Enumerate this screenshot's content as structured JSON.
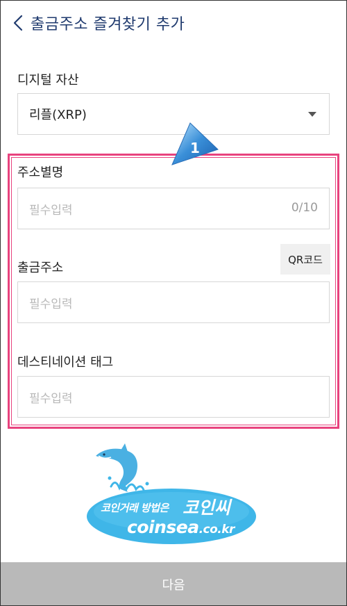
{
  "header": {
    "title": "출금주소 즐겨찾기 추가"
  },
  "asset": {
    "label": "디지털 자산",
    "selected": "리플(XRP)"
  },
  "alias": {
    "label": "주소별명",
    "placeholder": "필수입력",
    "counter": "0/10"
  },
  "address": {
    "label": "출금주소",
    "placeholder": "필수입력",
    "qr_button": "QR코드"
  },
  "destination_tag": {
    "label": "데스티네이션 태그",
    "placeholder": "필수입력"
  },
  "annotation": {
    "badge_number": "1",
    "highlight_color": "#e8427e"
  },
  "watermark": {
    "line1": "코인거래 방법은",
    "brand_korean": "코인씨",
    "brand_main": "coinsea",
    "brand_suffix": ".co.kr"
  },
  "footer": {
    "next_label": "다음"
  },
  "colors": {
    "title": "#1f3a6e",
    "button_disabled": "#b9b9b9",
    "watermark_bg": "#3fb6e8"
  }
}
